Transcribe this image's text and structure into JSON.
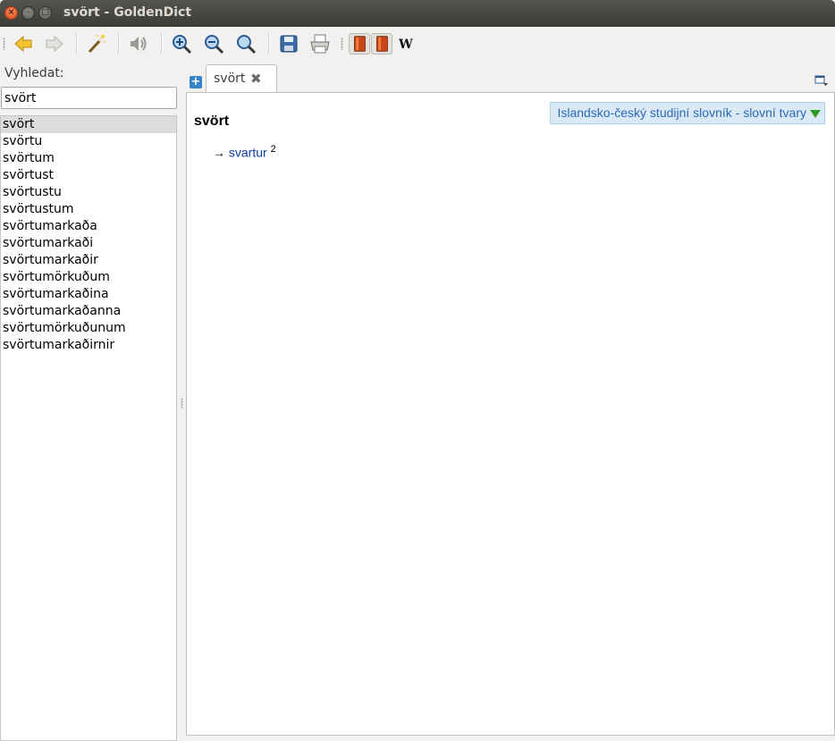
{
  "window": {
    "title": "svört - GoldenDict"
  },
  "search": {
    "label": "Vyhledat:",
    "value": "svört"
  },
  "word_list": [
    "svört",
    "svörtu",
    "svörtum",
    "svörtust",
    "svörtustu",
    "svörtustum",
    "svörtumarkaða",
    "svörtumarkaði",
    "svörtumarkaðir",
    "svörtumörkuðum",
    "svörtumarkaðina",
    "svörtumarkaðanna",
    "svörtumörkuðunum",
    "svörtumarkaðirnir"
  ],
  "tab": {
    "label": "svört",
    "close": "✖"
  },
  "article": {
    "dictionary": "Islandsko-český studijní slovník - slovní tvary",
    "headword": "svört",
    "arrow": "→",
    "link": "svartur",
    "sup": "2"
  },
  "toolbar_icons": [
    "back-icon",
    "forward-icon",
    "wand-icon",
    "speaker-icon",
    "zoom-in-icon",
    "zoom-out-icon",
    "zoom-reset-icon",
    "save-icon",
    "print-icon",
    "dictionary-icon",
    "dictionary-icon",
    "wikipedia-icon"
  ]
}
